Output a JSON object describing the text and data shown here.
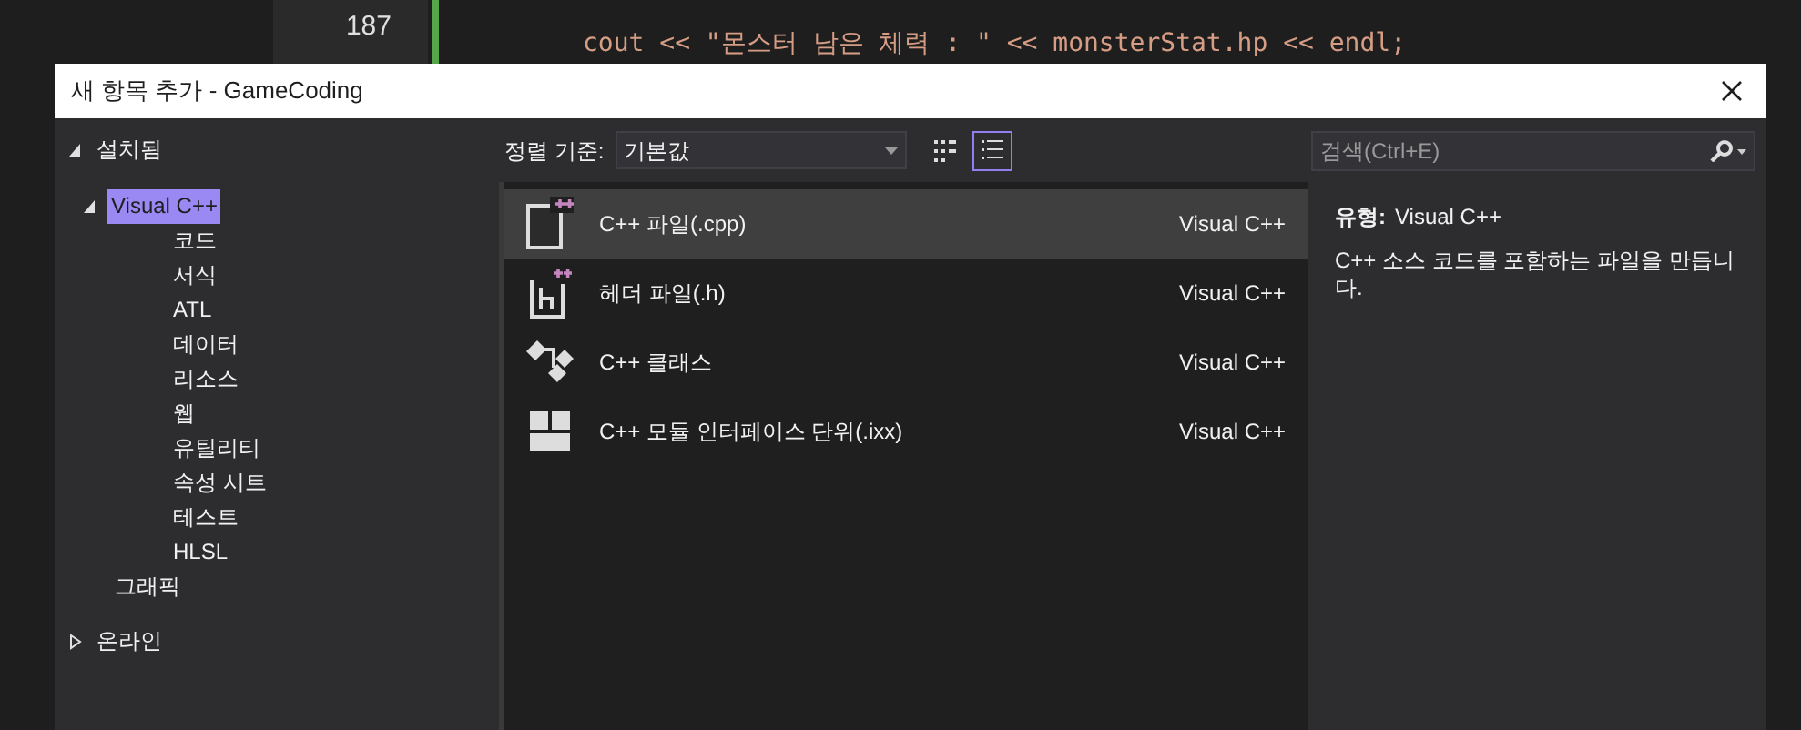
{
  "editor": {
    "line_numbers": [
      "187"
    ],
    "code_line": "cout << \"몬스터 남은 체력 : \" << monsterStat.hp << endl;"
  },
  "window": {
    "title": "새 항목 추가 - GameCoding"
  },
  "tree": [
    {
      "label": "설치됨",
      "expanded": true,
      "selected": false,
      "children": [
        {
          "label": "Visual C++",
          "expanded": true,
          "selected": true,
          "children": [
            {
              "label": "코드",
              "selected": false
            },
            {
              "label": "서식",
              "selected": false
            },
            {
              "label": "ATL",
              "selected": false
            },
            {
              "label": "데이터",
              "selected": false
            },
            {
              "label": "리소스",
              "selected": false
            },
            {
              "label": "웹",
              "selected": false
            },
            {
              "label": "유틸리티",
              "selected": false
            },
            {
              "label": "속성 시트",
              "selected": false
            },
            {
              "label": "테스트",
              "selected": false
            },
            {
              "label": "HLSL",
              "selected": false
            }
          ]
        },
        {
          "label": "그래픽",
          "selected": false
        }
      ]
    },
    {
      "label": "온라인",
      "expanded": false,
      "selected": false
    }
  ],
  "sort": {
    "label": "정렬 기준:",
    "value": "기본값"
  },
  "view_buttons": [
    {
      "kind": "grid",
      "selected": false
    },
    {
      "kind": "list",
      "selected": true
    }
  ],
  "templates": [
    {
      "kind": "cpp",
      "name": "C++ 파일(.cpp)",
      "type": "Visual C++",
      "selected": true
    },
    {
      "kind": "header",
      "name": "헤더 파일(.h)",
      "type": "Visual C++",
      "selected": false
    },
    {
      "kind": "class",
      "name": "C++ 클래스",
      "type": "Visual C++",
      "selected": false
    },
    {
      "kind": "module",
      "name": "C++ 모듈 인터페이스 단위(.ixx)",
      "type": "Visual C++",
      "selected": false
    }
  ],
  "search": {
    "placeholder": "검색(Ctrl+E)"
  },
  "details": {
    "type_label": "유형:",
    "type_value": "Visual C++",
    "description": "C++ 소스 코드를 포함하는 파일을 만듭니다."
  }
}
